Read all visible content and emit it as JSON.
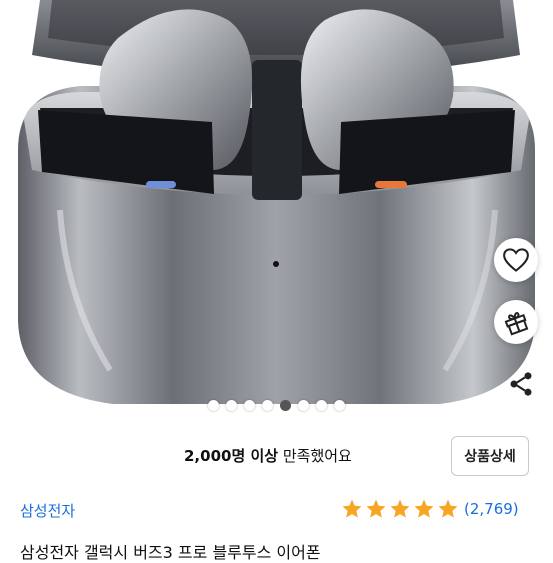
{
  "product_image": {
    "alt_icon": "earbuds-case-image"
  },
  "carousel": {
    "total": 8,
    "active_index": 4
  },
  "actions": {
    "wishlist_icon": "heart-icon",
    "gift_icon": "gift-icon",
    "share_icon": "share-icon"
  },
  "satisfaction": {
    "count_text": "2,000명 이상",
    "suffix_text": "만족했어요"
  },
  "detail_button": {
    "label": "상품상세"
  },
  "brand": {
    "name": "삼성전자"
  },
  "rating": {
    "stars": 5,
    "max": 5,
    "count_text": "(2,769)"
  },
  "product": {
    "title_partial": "삼성전자 갤럭시 버즈3 프로 블루투스 이어폰"
  },
  "colors": {
    "brand_blue": "#1a6fe0",
    "star_gold": "#f5a623"
  }
}
